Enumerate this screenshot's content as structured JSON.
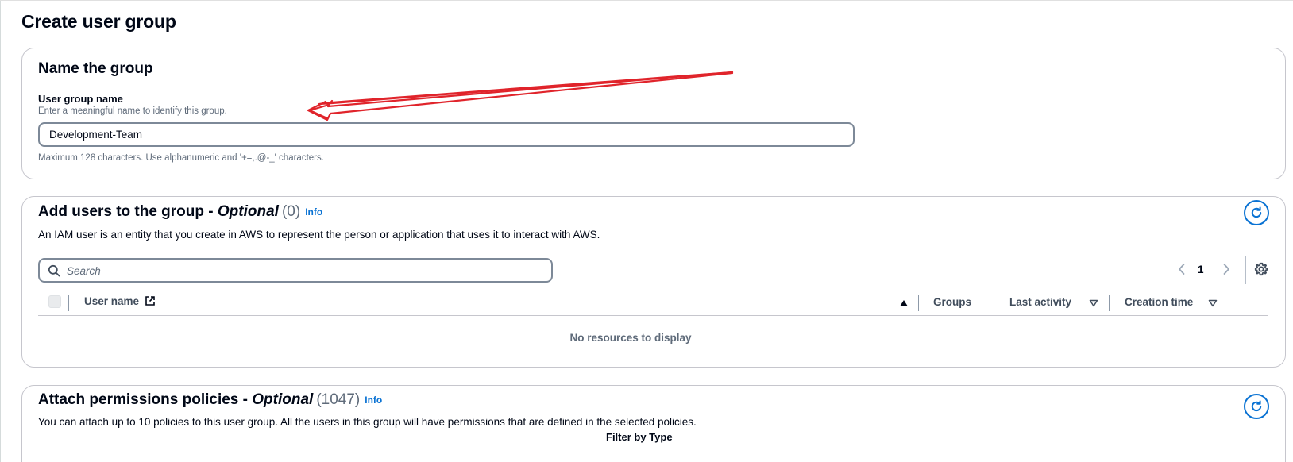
{
  "page": {
    "title": "Create user group"
  },
  "name_section": {
    "heading": "Name the group",
    "field_label": "User group name",
    "field_description": "Enter a meaningful name to identify this group.",
    "field_value": "Development-Team",
    "constraint_text": "Maximum 128 characters. Use alphanumeric and '+=,.@-_' characters."
  },
  "users_section": {
    "heading_main": "Add users to the group - ",
    "heading_optional": "Optional",
    "count": "(0)",
    "info_label": "Info",
    "description": "An IAM user is an entity that you create in AWS to represent the person or application that uses it to interact with AWS.",
    "search_placeholder": "Search",
    "pagination": {
      "current_page": "1"
    },
    "table": {
      "columns": {
        "user_name": "User name",
        "groups": "Groups",
        "last_activity": "Last activity",
        "creation_time": "Creation time"
      },
      "empty_message": "No resources to display"
    }
  },
  "policies_section": {
    "heading_main": "Attach permissions policies - ",
    "heading_optional": "Optional",
    "count": "(1047)",
    "info_label": "Info",
    "description": "You can attach up to 10 policies to this user group. All the users in this group will have permissions that are defined in the selected policies.",
    "filter_label": "Filter by Type"
  },
  "icons": {
    "refresh": "refresh-icon",
    "search": "search-icon",
    "settings": "gear-icon",
    "external_link": "external-link-icon",
    "sort_ascending": "sort-ascending-icon",
    "sort_descending": "sort-descending-icon",
    "chevron_left": "chevron-left-icon",
    "chevron_right": "chevron-right-icon"
  },
  "colors": {
    "link": "#0972d3",
    "annotation_arrow": "#e0242b",
    "muted_text": "#5f6b7a",
    "border": "#c6c6cd"
  }
}
